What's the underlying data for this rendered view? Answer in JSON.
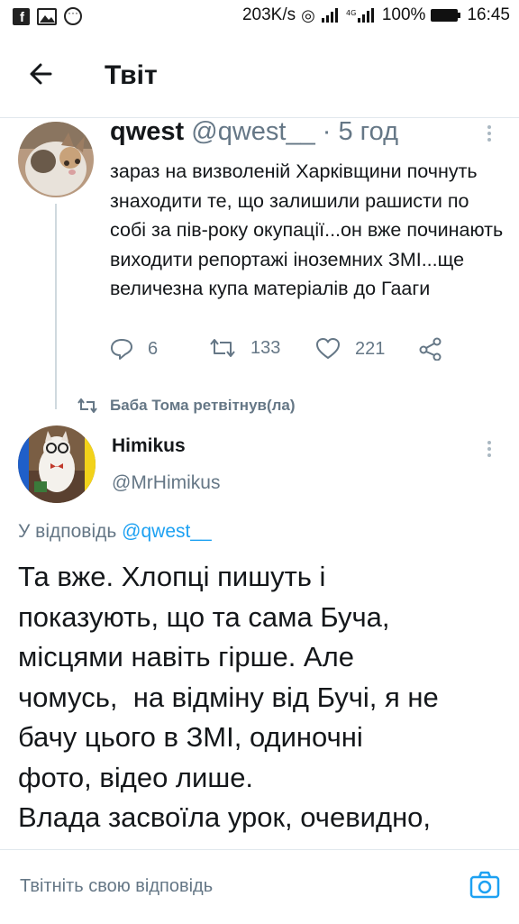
{
  "status_bar": {
    "speed": "203K/s",
    "battery": "100%",
    "time": "16:45",
    "icons": [
      "facebook-icon",
      "gallery-icon",
      "messenger-icon",
      "hotspot-icon",
      "signal-icon",
      "signal-4g-icon",
      "battery-icon"
    ]
  },
  "header": {
    "back_icon": "arrow-left-icon",
    "title": "Твіт"
  },
  "tweet1": {
    "name": "qwest",
    "handle": "@qwest__",
    "sep": "·",
    "time": "5 год",
    "text": "зараз на визволеній Харківщини почнуть знаходити те, що залишили рашисти по собі за пів-року окупації...он вже починають виходити репортажі іноземних ЗМІ...ще величезна купа матеріалів до Гааги",
    "replies": "6",
    "retweets": "133",
    "likes": "221"
  },
  "retweet_note": {
    "text": "Баба Тома ретвітнув(ла)"
  },
  "tweet2": {
    "name": "Himikus",
    "handle": "@MrHimikus",
    "reply_prefix": "У відповідь",
    "reply_to": "@qwest__",
    "lines": [
      "Та вже. Хлопці пишуть і",
      "показують, що та сама Буча,",
      "місцями навіть гірше. Але",
      "чомусь,  на відміну від Бучі, я не",
      "бачу цього в ЗМІ, одиночні",
      "фото, відео лише.",
      "Влада засвоїла урок, очевидно,"
    ]
  },
  "reply_bar": {
    "placeholder": "Твітніть свою відповідь"
  },
  "colors": {
    "link": "#1da1f2",
    "muted": "#657786",
    "text": "#14171a",
    "divider": "#e1e8ed"
  }
}
